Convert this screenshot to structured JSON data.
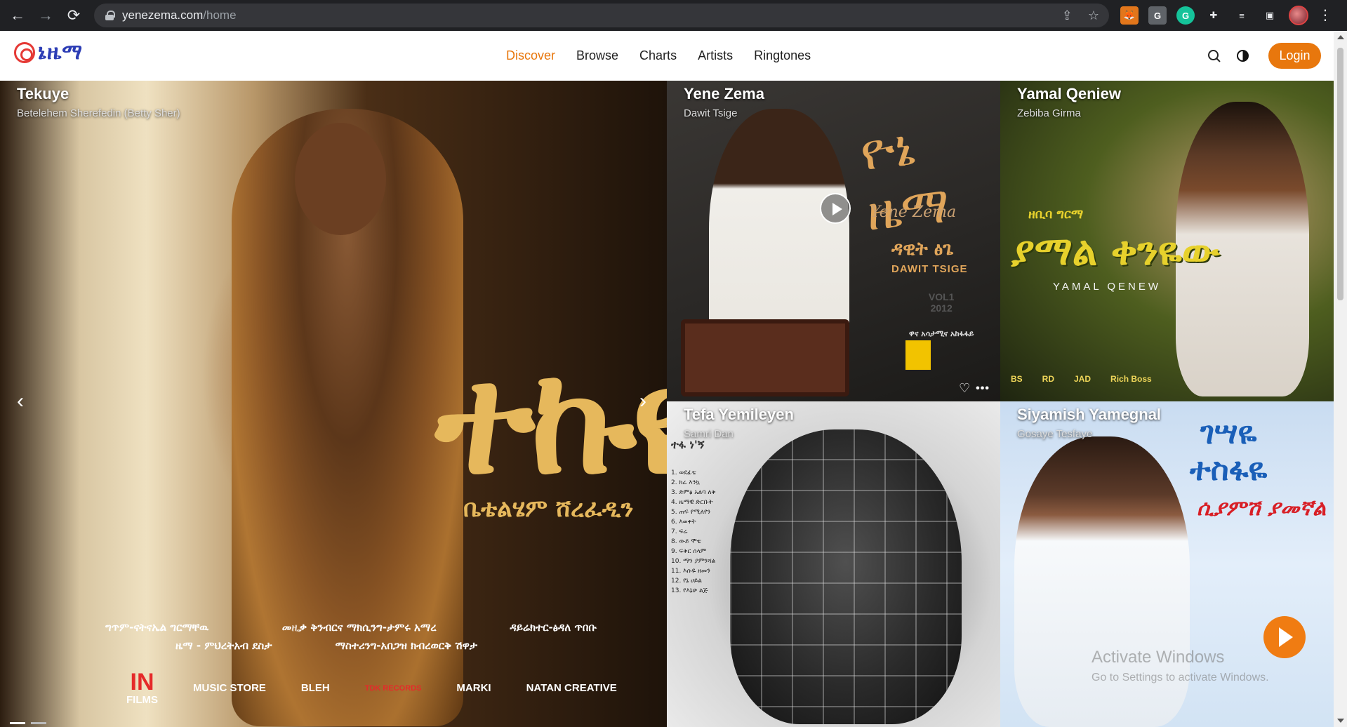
{
  "browser": {
    "url_host": "yenezema.com",
    "url_path": "/home",
    "nav": {
      "back": "←",
      "forward": "→",
      "reload": "⟳"
    },
    "ext_icons": [
      "fox-extension",
      "G",
      "grammarly",
      "puzzle",
      "media",
      "panel"
    ],
    "menu": "⋮"
  },
  "site": {
    "logo_text": "ኔዜማ",
    "nav": [
      {
        "label": "Discover",
        "active": true
      },
      {
        "label": "Browse",
        "active": false
      },
      {
        "label": "Charts",
        "active": false
      },
      {
        "label": "Artists",
        "active": false
      },
      {
        "label": "Ringtones",
        "active": false
      }
    ],
    "login_label": "Login",
    "accent": "#e8770d"
  },
  "hero": {
    "main": {
      "title": "Tekuye",
      "artist": "Betelehem Sherefedin (Betty Sher)",
      "art_title": "ተኩዬ",
      "art_artist": "ቤቴልሄም ሸረፈዲን",
      "credits_row1": [
        "ግጥም-ናትናኤል ግርማቸዉ",
        "መዚቃ ቅንብርና ማክሲንግ-ታምሩ አማረ",
        "ዳይሬክተር-ፅዳለ ጥበቡ"
      ],
      "credits_row2": [
        "ዜማ - ምህረትአብ ደስታ",
        "ማስተሪንግ-አበጋዝ ክብረወርቅ ሽዋታ"
      ],
      "logos": [
        "IN FILMS",
        "MUSIC STORE",
        "BLEH",
        "TDK RECORDS",
        "MARKI",
        "NATAN CREATIVE"
      ],
      "prev": "‹",
      "next": "›"
    },
    "yene": {
      "title": "Yene Zema",
      "artist": "Dawit Tsige",
      "art_title": "ዮኔ ዜማ",
      "art_script": "Yene Zema",
      "art_name_am": "ዳዊት ፅጌ",
      "art_name_en": "DAWIT TSIGE",
      "art_vol": "VOL1",
      "art_year": "2012",
      "art_label": "ዋና አሳታሚና አከፋፋይ"
    },
    "yamal": {
      "title": "Yamal Qeniew",
      "artist": "Zebiba Girma",
      "art_pre": "ዘቢባ ግርማ",
      "art_title": "ያማል ቀንዬው",
      "art_en": "YAMAL QENEW",
      "art_logos": [
        "BS",
        "RD",
        "JAD",
        "Rich Boss"
      ]
    },
    "tefa": {
      "title": "Tefa Yemileyen",
      "artist": "Samri Dan",
      "art_header": "ተፋ ነ'ኝ",
      "tracks": [
        "1. ወደፊቴ",
        "2. ክሬ እንኳ",
        "3. ድምፅ አልባ ለቅ",
        "4. ዜማዊ ድርቡት",
        "5. ጠፍ የሚለየን",
        "6. እወቀት",
        "7. ፍሬ",
        "8. ውይ ሞቴ",
        "9. ፍቅር ሰላም",
        "10. ማን ያምንሻል",
        "11. እሱዬ ዘመን",
        "12. የኔ ሀይል",
        "13. የእኔሁ ልጅ"
      ]
    },
    "siya": {
      "title": "Siyamish Yamegnal",
      "artist": "Gosaye Tesfaye",
      "art_title_1": "ገሣዬ",
      "art_title_2": "ተስፋዬ",
      "art_sub": "ሲያምሽ ያመኛል"
    }
  },
  "watermark": {
    "line1": "Activate Windows",
    "line2": "Go to Settings to activate Windows."
  }
}
